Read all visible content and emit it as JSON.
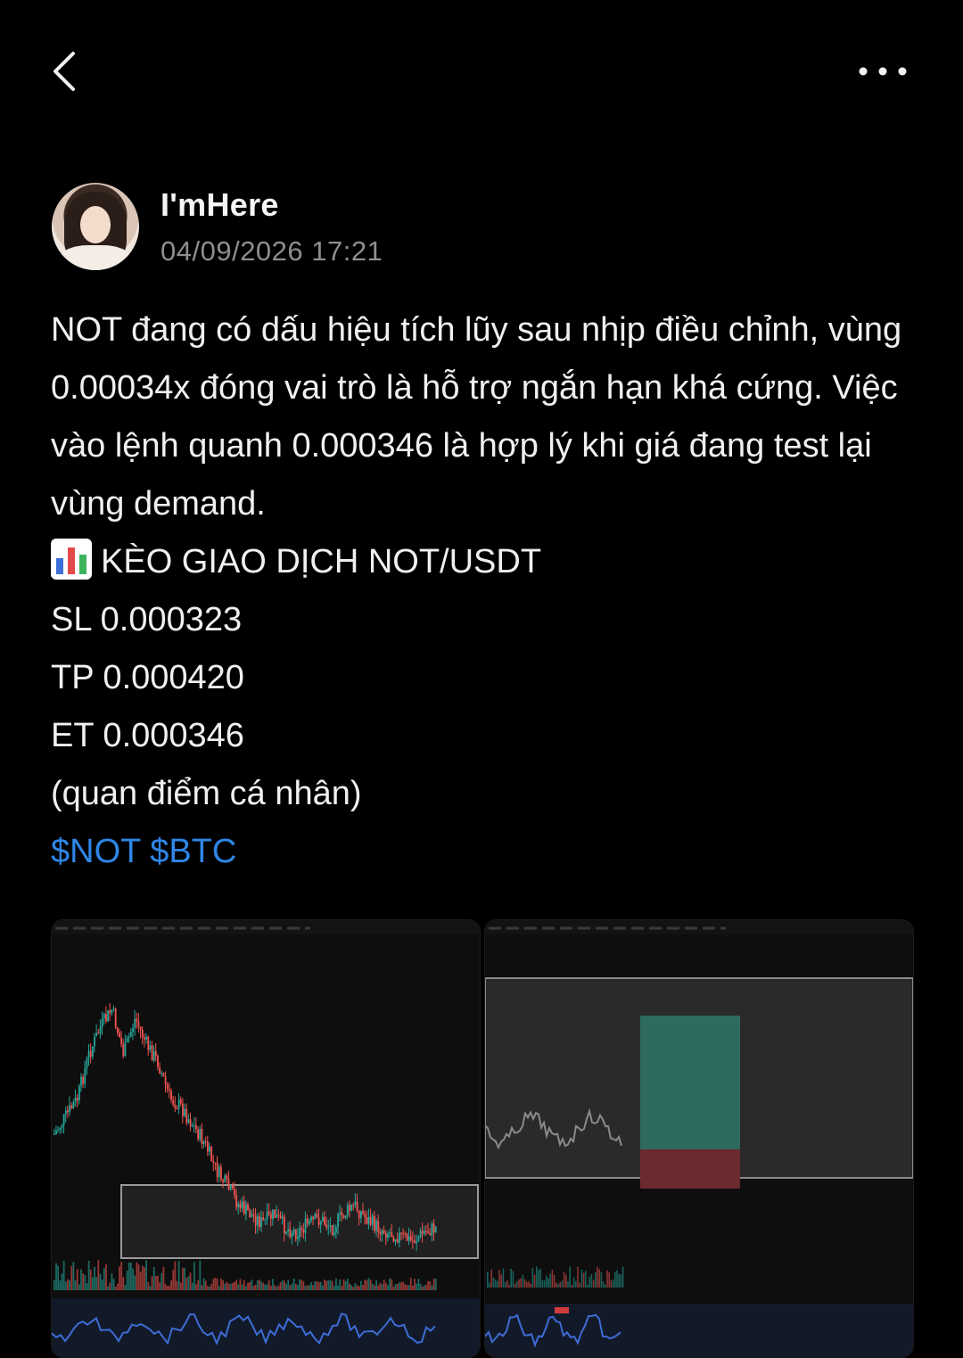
{
  "nav": {
    "back_icon": "chevron-left-icon",
    "more_icon": "more-horizontal-icon"
  },
  "post": {
    "author": "I'mHere",
    "timestamp": "04/09/2026 17:21",
    "paragraph": "NOT đang có dấu hiệu tích lũy sau nhịp điều chỉnh, vùng 0.00034x đóng vai trò là hỗ trợ ngắn hạn khá cứng. Việc vào lệnh quanh 0.000346 là hợp lý khi giá đang test lại vùng demand.",
    "signal_title": "KÈO GIAO DỊCH NOT/USDT",
    "sl": "SL 0.000323",
    "tp": "TP 0.000420",
    "et": "ET 0.000346",
    "note": "(quan điểm cá nhân)",
    "hashtags": [
      "$NOT",
      "$BTC"
    ]
  },
  "colors": {
    "background": "#000000",
    "hashtag": "#2f86e6",
    "muted": "#8e8e8e",
    "candle_up": "#26a69a",
    "candle_down": "#ef5350"
  },
  "images": [
    {
      "name": "chart-screenshot-1"
    },
    {
      "name": "chart-screenshot-2"
    }
  ]
}
